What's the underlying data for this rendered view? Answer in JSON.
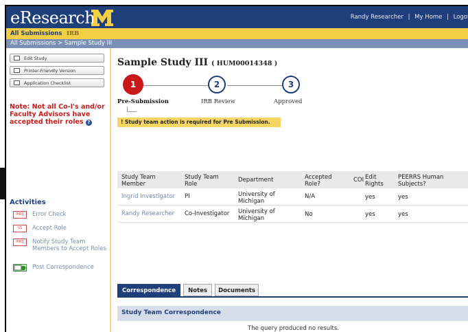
{
  "app": {
    "logo_text": "eResearch",
    "logo_mark": "M",
    "user_links": [
      "Randy Researcher",
      "|",
      "My Home",
      "|",
      "Logof"
    ]
  },
  "subnav": {
    "all_submissions": "All Submissions",
    "irb": "IRB"
  },
  "breadcrumb": "All Submissions  >  Sample Study III",
  "sidebar": {
    "buttons": [
      {
        "label": "Edit Study",
        "icon": "study-icon"
      },
      {
        "label": "Printer-Friendly Version",
        "icon": "printer-icon"
      },
      {
        "label": "Application Checklist",
        "icon": "checklist-icon"
      }
    ],
    "warning": "Note: Not all Co-I's and/or Faculty Advisors have accepted their roles",
    "help_glyph": "?",
    "activities_heading": "Activities",
    "activities": [
      {
        "label": "Error Check",
        "icon_text": "PIRS"
      },
      {
        "label": "Accept Role",
        "icon_text": "SS"
      },
      {
        "label": "Notify Study Team Members to Accept Roles",
        "icon_text": "PIRS"
      },
      {
        "label": "Post Correspondence",
        "icon_text": ""
      }
    ]
  },
  "study": {
    "title": "Sample Study III",
    "code": "( HUM00014348 )"
  },
  "steps": [
    {
      "number": "1",
      "label": "Pre-Submission",
      "current": true
    },
    {
      "number": "2",
      "label": "IRB Review",
      "current": false
    },
    {
      "number": "3",
      "label": "Approved",
      "current": false
    }
  ],
  "notice": "!  Study team action is required for Pre Submission.",
  "team_table": {
    "headers": [
      "Study Team Member",
      "Study Team Role",
      "Department",
      "Accepted Role?",
      "COI",
      "Edit Rights",
      "PEERRS Human Subjects?"
    ],
    "rows": [
      [
        "Ingrid Investigator",
        "PI",
        "University of Michigan",
        "N/A",
        "",
        "yes",
        "yes"
      ],
      [
        "Randy Researcher",
        "Co-Investigator",
        "University of Michigan",
        "No",
        "",
        "yes",
        "yes"
      ]
    ]
  },
  "tabs": [
    "Correspondence",
    "Notes",
    "Documents"
  ],
  "correspondence": {
    "heading": "Study Team Correspondence",
    "empty": "The query produced no results."
  },
  "colors": {
    "navy": "#1f3f7a",
    "gold": "#f3cf45",
    "alert_red": "#c91818"
  }
}
